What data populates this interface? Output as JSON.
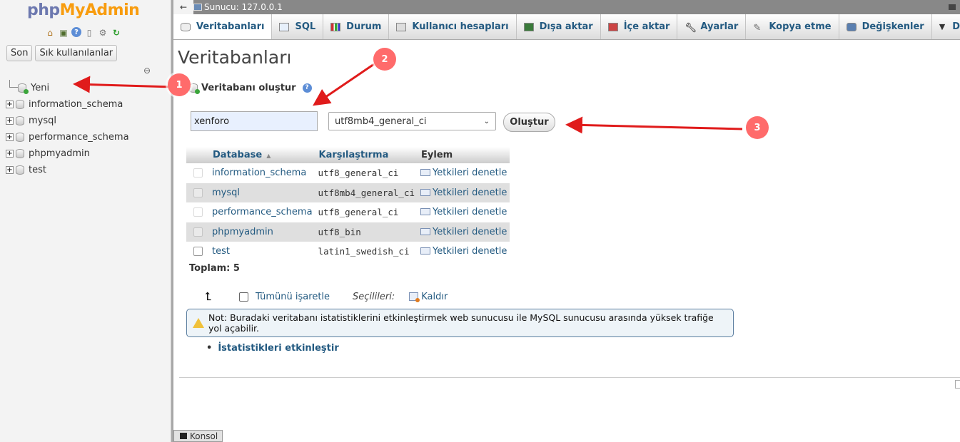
{
  "sidebar": {
    "logo_php": "php",
    "logo_myadmin": "MyAdmin",
    "quick_icons": [
      "home-icon",
      "exit-icon",
      "help-icon",
      "docs-icon",
      "settings-icon",
      "reload-icon"
    ],
    "recent_label": "Son",
    "favorites_label": "Sık kullanılanlar",
    "tree": [
      {
        "label": "Yeni",
        "type": "new"
      },
      {
        "label": "information_schema",
        "type": "db"
      },
      {
        "label": "mysql",
        "type": "db"
      },
      {
        "label": "performance_schema",
        "type": "db"
      },
      {
        "label": "phpmyadmin",
        "type": "db"
      },
      {
        "label": "test",
        "type": "db"
      }
    ]
  },
  "server_bar": {
    "back_glyph": "←",
    "label": "Sunucu: 127.0.0.1"
  },
  "tabs": [
    {
      "label": "Veritabanları",
      "icon": "database-icon",
      "active": true
    },
    {
      "label": "SQL",
      "icon": "sql-icon"
    },
    {
      "label": "Durum",
      "icon": "status-chart-icon"
    },
    {
      "label": "Kullanıcı hesapları",
      "icon": "user-accounts-icon"
    },
    {
      "label": "Dışa aktar",
      "icon": "export-icon"
    },
    {
      "label": "İçe aktar",
      "icon": "import-icon"
    },
    {
      "label": "Ayarlar",
      "icon": "wrench-icon"
    },
    {
      "label": "Kopya etme",
      "icon": "replication-icon"
    },
    {
      "label": "Değişkenler",
      "icon": "variables-icon"
    },
    {
      "label": "Daha fazla",
      "icon": "caret-down-icon"
    }
  ],
  "main": {
    "title": "Veritabanları",
    "create_heading": "Veritabanı oluştur",
    "db_name_value": "xenforo",
    "collation_selected": "utf8mb4_general_ci",
    "create_button": "Oluştur",
    "table": {
      "headers": {
        "database": "Database",
        "collation": "Karşılaştırma",
        "action": "Eylem"
      },
      "sort_glyph": "▲",
      "rows": [
        {
          "name": "information_schema",
          "collation": "utf8_general_ci",
          "action": "Yetkileri denetle",
          "selectable": false
        },
        {
          "name": "mysql",
          "collation": "utf8mb4_general_ci",
          "action": "Yetkileri denetle",
          "selectable": false
        },
        {
          "name": "performance_schema",
          "collation": "utf8_general_ci",
          "action": "Yetkileri denetle",
          "selectable": false
        },
        {
          "name": "phpmyadmin",
          "collation": "utf8_bin",
          "action": "Yetkileri denetle",
          "selectable": false
        },
        {
          "name": "test",
          "collation": "latin1_swedish_ci",
          "action": "Yetkileri denetle",
          "selectable": true
        }
      ]
    },
    "total": "Toplam: 5",
    "bulk": {
      "arrow_glyph": "⮤",
      "check_all": "Tümünü işaretle",
      "with_selected": "Seçilileri:",
      "drop": "Kaldır"
    },
    "notice": "Not: Buradaki veritabanı istatistiklerini etkinleştirmek web sunucusu ile MySQL sunucusu arasında yüksek trafiğe yol açabilir.",
    "enable_stats": "İstatistikleri etkinleştir"
  },
  "console_label": "Konsol",
  "annotations": {
    "badges": [
      "1",
      "2",
      "3"
    ],
    "color": "#ff6b6b",
    "arrow_color": "#e01b1b"
  }
}
